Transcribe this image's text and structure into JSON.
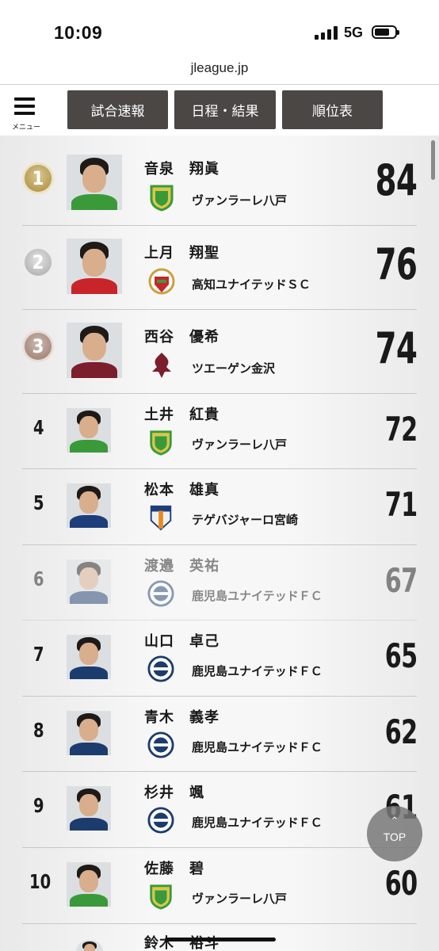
{
  "status": {
    "time": "10:09",
    "network": "5G"
  },
  "browser": {
    "url": "jleague.jp"
  },
  "nav": {
    "menu_label": "メニュー",
    "buttons": [
      "試合速報",
      "日程・結果",
      "順位表"
    ]
  },
  "ranking": [
    {
      "rank": "1",
      "name": "音泉　翔眞",
      "club": "ヴァンラーレ八戸",
      "points": "84",
      "club_color": "#3a9a3a"
    },
    {
      "rank": "2",
      "name": "上月　翔聖",
      "club": "高知ユナイテッドＳＣ",
      "points": "76",
      "club_color": "#c8252b"
    },
    {
      "rank": "3",
      "name": "西谷　優希",
      "club": "ツエーゲン金沢",
      "points": "74",
      "club_color": "#7a1f2b"
    },
    {
      "rank": "4",
      "name": "土井　紅貴",
      "club": "ヴァンラーレ八戸",
      "points": "72",
      "club_color": "#3a9a3a"
    },
    {
      "rank": "5",
      "name": "松本　雄真",
      "club": "テゲバジャーロ宮崎",
      "points": "71",
      "club_color": "#1d3e7a"
    },
    {
      "rank": "6",
      "name": "渡邉　英祐",
      "club": "鹿児島ユナイテッドＦＣ",
      "points": "67",
      "club_color": "#1c3c6e"
    },
    {
      "rank": "7",
      "name": "山口　卓己",
      "club": "鹿児島ユナイテッドＦＣ",
      "points": "65",
      "club_color": "#1c3c6e"
    },
    {
      "rank": "8",
      "name": "青木　義孝",
      "club": "鹿児島ユナイテッドＦＣ",
      "points": "62",
      "club_color": "#1c3c6e"
    },
    {
      "rank": "9",
      "name": "杉井　颯",
      "club": "鹿児島ユナイテッドＦＣ",
      "points": "61",
      "club_color": "#1c3c6e"
    },
    {
      "rank": "10",
      "name": "佐藤　碧",
      "club": "ヴァンラーレ八戸",
      "points": "60",
      "club_color": "#3a9a3a"
    },
    {
      "rank": "",
      "name": "鈴木　裕斗",
      "club": "",
      "points": "",
      "club_color": "#3a9a3a"
    }
  ],
  "top_button": {
    "label": "TOP"
  }
}
